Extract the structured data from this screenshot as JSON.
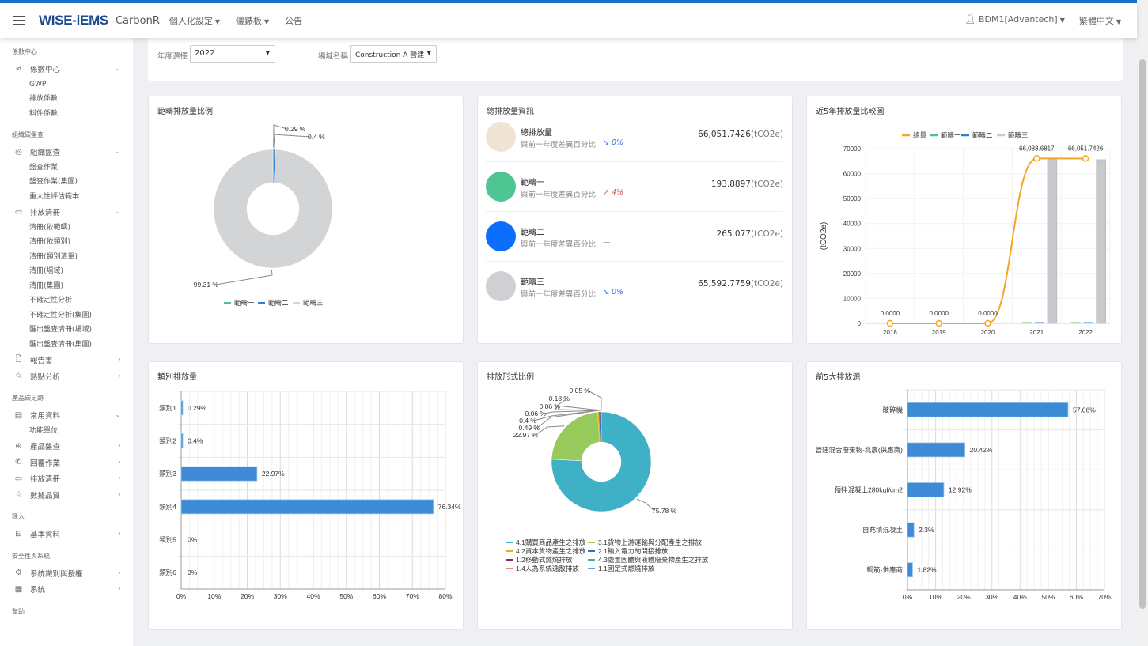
{
  "header": {
    "logo": "WISE-iEMS",
    "app": "CarbonR",
    "nav": [
      "個人化設定",
      "儀錶板",
      "公告"
    ],
    "user": "BDM1[Advantech]",
    "language": "繁體中文"
  },
  "sidebar": {
    "sections": [
      {
        "title": "係數中心",
        "items": [
          {
            "label": "係數中心",
            "icon": "share-icon",
            "expanded": true,
            "children": [
              "GWP",
              "排放係數",
              "料件係數"
            ]
          }
        ]
      },
      {
        "title": "組織碳盤查",
        "items": [
          {
            "label": "組織盤查",
            "icon": "target-icon",
            "expanded": true,
            "children": [
              "盤查作業",
              "盤查作業(集團)",
              "重大性評估範本"
            ]
          },
          {
            "label": "排放清冊",
            "icon": "book-icon",
            "expanded": true,
            "children": [
              "清冊(依範疇)",
              "清冊(依類別)",
              "清冊(類別清單)",
              "清冊(場域)",
              "清冊(集團)",
              "不確定性分析",
              "不確定性分析(集團)",
              "匯出盤查清冊(場域)",
              "匯出盤查清冊(集團)"
            ]
          },
          {
            "label": "報告書",
            "icon": "file-icon",
            "expanded": false,
            "children": []
          },
          {
            "label": "熱點分析",
            "icon": "star-icon",
            "expanded": false,
            "children": []
          }
        ]
      },
      {
        "title": "產品碳足跡",
        "items": [
          {
            "label": "常用資料",
            "icon": "archive-icon",
            "expanded": true,
            "children": [
              "功能單位"
            ]
          },
          {
            "label": "產品盤查",
            "icon": "badge-icon",
            "expanded": false,
            "children": []
          },
          {
            "label": "回覆作業",
            "icon": "phone-icon",
            "expanded": false,
            "children": []
          },
          {
            "label": "排放清冊",
            "icon": "folder-icon",
            "expanded": false,
            "children": []
          },
          {
            "label": "數據品質",
            "icon": "star-icon",
            "expanded": false,
            "children": []
          }
        ]
      },
      {
        "title": "匯入",
        "items": [
          {
            "label": "基本資料",
            "icon": "inbox-icon",
            "expanded": false,
            "children": []
          }
        ]
      },
      {
        "title": "安全性與系統",
        "items": [
          {
            "label": "系統識別與授權",
            "icon": "gear-icon",
            "expanded": false,
            "children": []
          },
          {
            "label": "系統",
            "icon": "calendar-icon",
            "expanded": false,
            "children": []
          }
        ]
      },
      {
        "title": "幫助",
        "items": []
      }
    ]
  },
  "filter": {
    "year_label": "年度選擇",
    "year": "2022",
    "site_label": "場域名稱",
    "site": "Construction A 營建"
  },
  "cards": {
    "scope_ratio": {
      "title": "範疇排放量比例"
    },
    "summary": {
      "title": "總排放量資訊",
      "diff_label": "與前一年度差異百分比",
      "unit": "(tCO2e)",
      "rows": [
        {
          "name": "總排放量",
          "value": "66,051.7426",
          "trend": "0%",
          "direction": "down",
          "color": "#f0e4d4"
        },
        {
          "name": "範疇一",
          "value": "193.8897",
          "trend": "4%",
          "direction": "up",
          "color": "#4fc593"
        },
        {
          "name": "範疇二",
          "value": "265.077",
          "trend": "—",
          "direction": "none",
          "color": "#0d6efd"
        },
        {
          "name": "範疇三",
          "value": "65,592.7759",
          "trend": "0%",
          "direction": "down",
          "color": "#cfd0d3"
        }
      ]
    },
    "five_year": {
      "title": "近5年排放量比較圖"
    },
    "category": {
      "title": "類別排放量"
    },
    "emission_type": {
      "title": "排放形式比例"
    },
    "top5": {
      "title": "前5大排放源"
    }
  },
  "chart_data": [
    {
      "type": "pie",
      "donut": true,
      "legend": "bottom",
      "labels": [
        "範疇一",
        "範疇二",
        "範疇三"
      ],
      "values": [
        0.29,
        0.4,
        99.31
      ],
      "data_labels": [
        "0.29 %",
        "0.4 %",
        "99.31 %"
      ],
      "colors": [
        "#4fc08d",
        "#2f7ed8",
        "#d3d4d6"
      ]
    },
    {
      "type": "line",
      "legend": "top",
      "categories": [
        "2018",
        "2019",
        "2020",
        "2021",
        "2022"
      ],
      "ylabel": "(tCO2e)",
      "ylim": [
        0,
        70000
      ],
      "yticks": [
        0,
        10000,
        20000,
        30000,
        40000,
        50000,
        60000,
        70000
      ],
      "grid": true,
      "series": [
        {
          "name": "總量",
          "type": "line",
          "values": [
            0,
            0,
            0,
            66088.6817,
            66051.7426
          ],
          "data_labels": [
            "0.0000",
            "0.0000",
            "0.0000",
            "66,088.6817",
            "66,051.7426"
          ],
          "color": "#f5a623"
        },
        {
          "name": "範疇一",
          "type": "bar",
          "values": [
            0,
            0,
            0,
            193,
            193.8897
          ],
          "color": "#4fc08d"
        },
        {
          "name": "範疇二",
          "type": "bar",
          "values": [
            0,
            0,
            0,
            265,
            265.077
          ],
          "color": "#2f7ed8"
        },
        {
          "name": "範疇三",
          "type": "bar",
          "values": [
            0,
            0,
            0,
            65630,
            65592.7759
          ],
          "color": "#c8c9cc"
        }
      ]
    },
    {
      "type": "bar",
      "orientation": "horizontal",
      "categories": [
        "類別1",
        "類別2",
        "類別3",
        "類別4",
        "類別5",
        "類別6"
      ],
      "values": [
        0.29,
        0.4,
        22.97,
        76.34,
        0,
        0
      ],
      "data_labels": [
        "0.29%",
        "0.4%",
        "22.97%",
        "76.34%",
        "0%",
        "0%"
      ],
      "xlim": [
        0,
        80
      ],
      "xticks": [
        "0%",
        "10%",
        "20%",
        "30%",
        "40%",
        "50%",
        "60%",
        "70%",
        "80%"
      ],
      "grid": true,
      "color": "#3d8bd6"
    },
    {
      "type": "pie",
      "donut": true,
      "legend": "bottom",
      "labels": [
        "4.1購買商品產生之排放",
        "3.1貨物上游運輸與分配產生之排放",
        "4.2資本貨物產生之排放",
        "2.1輸入電力的間接排放",
        "1.2移動式燃燒排放",
        "4.3處置固體與液體廢棄物產生之排放",
        "1.4人為系統逸散排放",
        "1.1固定式燃燒排放"
      ],
      "values": [
        75.78,
        22.97,
        0.49,
        0.4,
        0.06,
        0.06,
        0.18,
        0.05
      ],
      "data_labels": [
        "75.78 %",
        "22.97 %",
        "0.49 %",
        "0.4 %",
        "0.06 %",
        "0.06 %",
        "0.18 %",
        "0.05 %"
      ],
      "colors": [
        "#3fb1c6",
        "#97c95c",
        "#f5a623",
        "#3a6fb0",
        "#8b2a5e",
        "#4aa8a0",
        "#f08080",
        "#5aa0e0"
      ]
    },
    {
      "type": "bar",
      "orientation": "horizontal",
      "categories": [
        "破碎機",
        "營建混合廢棄物-北宸(供應商)",
        "預拌混凝土280kgf/cm2",
        "自充填混凝土",
        "鋼筋-供應商"
      ],
      "values": [
        57.06,
        20.42,
        12.92,
        2.3,
        1.82
      ],
      "data_labels": [
        "57.06%",
        "20.42%",
        "12.92%",
        "2.3%",
        "1.82%"
      ],
      "xlim": [
        0,
        70
      ],
      "xticks": [
        "0%",
        "10%",
        "20%",
        "30%",
        "40%",
        "50%",
        "60%",
        "70%"
      ],
      "grid": true,
      "color": "#3d8bd6"
    }
  ]
}
